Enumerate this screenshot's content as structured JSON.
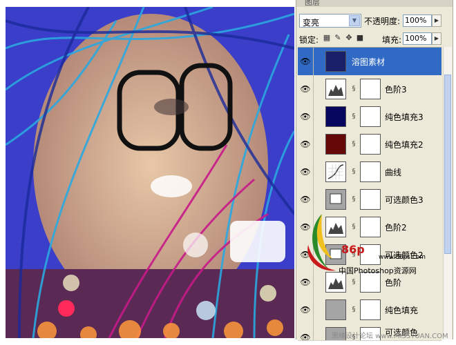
{
  "panel": {
    "title": "图层",
    "blend_mode": "变亮",
    "opacity_label": "不透明度:",
    "opacity_value": "100%",
    "lock_label": "锁定:",
    "fill_label": "填充:",
    "fill_value": "100%"
  },
  "layers": [
    {
      "name": "溶图素材",
      "selected": true,
      "thumb_color": "#1a1f6a"
    },
    {
      "name": "色阶3",
      "selected": false,
      "thumb_color": "#ffffff"
    },
    {
      "name": "纯色填充3",
      "selected": false,
      "thumb_color": "#06065e"
    },
    {
      "name": "纯色填充2",
      "selected": false,
      "thumb_color": "#650808"
    },
    {
      "name": "曲线",
      "selected": false,
      "thumb_color": "#ffffff"
    },
    {
      "name": "可选颜色3",
      "selected": false,
      "thumb_color": "#a5a5a5"
    },
    {
      "name": "色阶2",
      "selected": false,
      "thumb_color": "#ffffff"
    },
    {
      "name": "可选颜色2",
      "selected": false,
      "thumb_color": "#a5a5a5"
    },
    {
      "name": "色阶",
      "selected": false,
      "thumb_color": "#ffffff"
    },
    {
      "name": "纯色填充",
      "selected": false,
      "thumb_color": "#a5a5a5"
    },
    {
      "name": "可选颜色",
      "selected": false,
      "thumb_color": "#a5a5a5"
    }
  ],
  "watermark": {
    "logo_text": "86p",
    "url": "www.86ps.com",
    "cn_text": "中国Photoshop资源网",
    "bottom": "思缘设计论坛 www.MISSYUAN.COM"
  },
  "colors": {
    "selection": "#316ac5",
    "panel_bg": "#ece9d8"
  }
}
